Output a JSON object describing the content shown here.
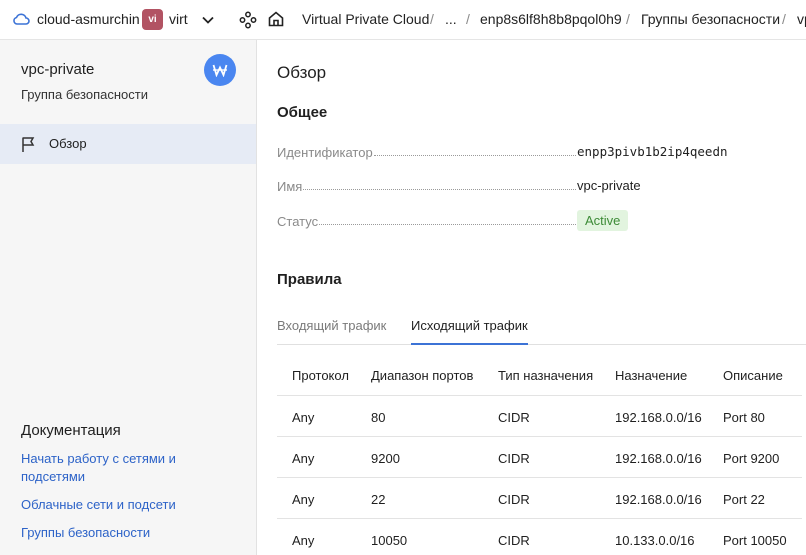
{
  "topbar": {
    "cloud_name": "cloud-asmurchin",
    "folder_badge": "vi",
    "folder_name": "virt",
    "breadcrumbs": [
      "Virtual Private Cloud",
      "...",
      "enp8s6lf8h8b8pqol0h9",
      "Группы безопасности",
      "vp"
    ]
  },
  "sidebar": {
    "title": "vpc-private",
    "subtitle": "Группа безопасности",
    "items": [
      {
        "label": "Обзор"
      }
    ],
    "docs_title": "Документация",
    "docs_links": [
      "Начать работу с сетями и подсетями",
      "Облачные сети и подсети",
      "Группы безопасности"
    ]
  },
  "main": {
    "title": "Обзор",
    "general_title": "Общее",
    "props": {
      "id_label": "Идентификатор",
      "id_value": "enpp3pivb1b2ip4qeedn",
      "name_label": "Имя",
      "name_value": "vpc-private",
      "status_label": "Статус",
      "status_value": "Active"
    },
    "rules_title": "Правила",
    "tabs": [
      {
        "label": "Входящий трафик",
        "active": false
      },
      {
        "label": "Исходящий трафик",
        "active": true
      }
    ],
    "table": {
      "headers": [
        "Протокол",
        "Диапазон портов",
        "Тип назначения",
        "Назначение",
        "Описание"
      ],
      "rows": [
        [
          "Any",
          "80",
          "CIDR",
          "192.168.0.0/16",
          "Port 80"
        ],
        [
          "Any",
          "9200",
          "CIDR",
          "192.168.0.0/16",
          "Port 9200"
        ],
        [
          "Any",
          "22",
          "CIDR",
          "192.168.0.0/16",
          "Port 22"
        ],
        [
          "Any",
          "10050",
          "CIDR",
          "10.133.0.0/16",
          "Port 10050"
        ]
      ]
    }
  },
  "colors": {
    "accent": "#3c73d6",
    "link": "#2d63c8",
    "folder_badge": "#b25363",
    "status_bg": "#e2f4df",
    "status_text": "#3d8b37",
    "selected_item_bg": "#e6ebf5"
  },
  "icons": [
    "cloud-icon",
    "chevron-down-icon",
    "services-icon",
    "home-icon",
    "vpc-service-icon",
    "flag-icon"
  ]
}
